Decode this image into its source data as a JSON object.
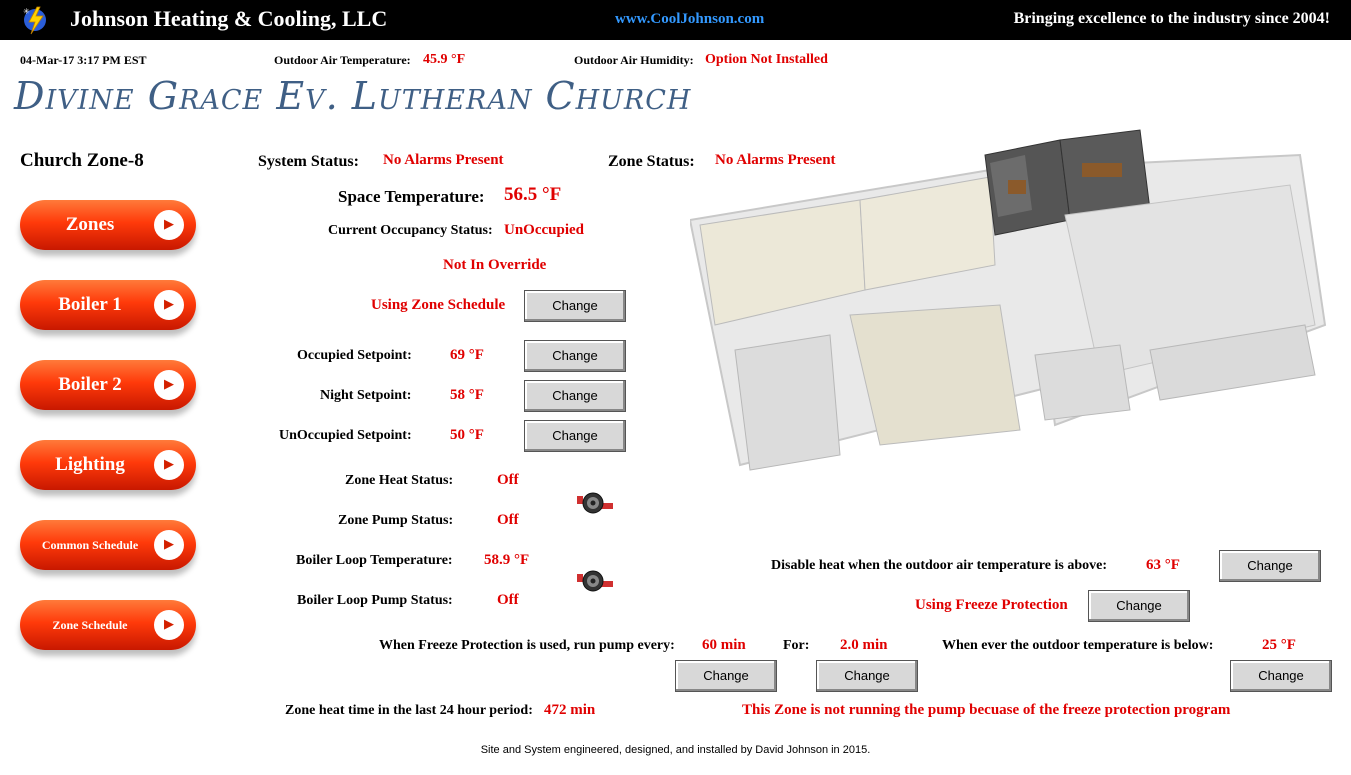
{
  "header": {
    "company": "Johnson Heating & Cooling, LLC",
    "website": "www.CoolJohnson.com",
    "tagline": "Bringing excellence to the industry since 2004!"
  },
  "info": {
    "datetime": "04-Mar-17 3:17 PM EST",
    "oat_label": "Outdoor Air Temperature:",
    "oat_value": "45.9 °F",
    "oah_label": "Outdoor Air Humidity:",
    "oah_value": "Option Not Installed"
  },
  "church_name": "Divine Grace Ev. Lutheran Church",
  "zone_title": "Church Zone-8",
  "nav": [
    {
      "label": "Zones"
    },
    {
      "label": "Boiler 1"
    },
    {
      "label": "Boiler 2"
    },
    {
      "label": "Lighting"
    },
    {
      "label": "Common Schedule"
    },
    {
      "label": "Zone Schedule"
    }
  ],
  "status": {
    "system_label": "System Status:",
    "system_value": "No Alarms Present",
    "zone_label": "Zone Status:",
    "zone_value": "No Alarms Present",
    "space_temp_label": "Space Temperature:",
    "space_temp_value": "56.5 °F",
    "occupancy_label": "Current Occupancy Status:",
    "occupancy_value": "UnOccupied",
    "override": "Not In Override",
    "schedule": "Using Zone Schedule"
  },
  "setpoints": {
    "occupied_label": "Occupied Setpoint:",
    "occupied_value": "69 °F",
    "night_label": "Night Setpoint:",
    "night_value": "58 °F",
    "unoccupied_label": "UnOccupied Setpoint:",
    "unoccupied_value": "50 °F"
  },
  "zone": {
    "heat_label": "Zone Heat Status:",
    "heat_value": "Off",
    "pump_label": "Zone Pump Status:",
    "pump_value": "Off",
    "loop_temp_label": "Boiler Loop Temperature:",
    "loop_temp_value": "58.9 °F",
    "loop_pump_label": "Boiler Loop Pump Status:",
    "loop_pump_value": "Off"
  },
  "freeze": {
    "disable_label": "Disable heat when the outdoor air temperature is above:",
    "disable_value": "63 °F",
    "using": "Using Freeze Protection",
    "run_label": "When Freeze Protection is used, run pump every:",
    "run_value": "60 min",
    "for_label": "For:",
    "for_value": "2.0 min",
    "below_label": "When ever the outdoor temperature is below:",
    "below_value": "25 °F",
    "message": "This Zone is not running the pump becuase of the freeze protection program"
  },
  "heat_time": {
    "label": "Zone heat time in the last 24 hour period:",
    "value": "472 min"
  },
  "change_label": "Change",
  "footer": "Site and System engineered, designed, and installed by David Johnson in 2015.",
  "colors": {
    "accent_red": "#e00000",
    "title_blue": "#3f5f85",
    "button_orange": "#ff3a0a",
    "link_blue": "#3399ff"
  }
}
